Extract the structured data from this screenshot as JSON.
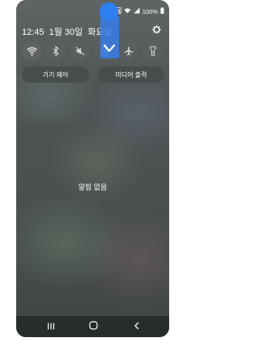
{
  "status_bar": {
    "time": "12:45",
    "date": "1월 30일",
    "weekday": "화요일",
    "battery_percent": "100%",
    "icons": [
      "bluetooth-icon",
      "nfc-icon",
      "wifi-icon",
      "signal-icon",
      "battery-icon"
    ]
  },
  "quick_tiles": [
    {
      "name": "wifi",
      "icon": "wifi-icon",
      "active": true
    },
    {
      "name": "bluetooth",
      "icon": "bluetooth-icon",
      "active": false
    },
    {
      "name": "sound-mute",
      "icon": "mute-icon",
      "active": false
    },
    {
      "name": "portrait-lock",
      "icon": "rotation-lock-icon",
      "active": false
    },
    {
      "name": "airplane-mode",
      "icon": "airplane-icon",
      "active": false
    },
    {
      "name": "flashlight",
      "icon": "flashlight-icon",
      "active": false
    }
  ],
  "buttons": {
    "device_control": "기기 제어",
    "media_output": "미디어 출력"
  },
  "notifications": {
    "empty_text": "알림 없음"
  },
  "gesture_hint": {
    "direction": "down",
    "color": "#2f7ff0"
  },
  "colors": {
    "panel_bg": "#4e5454",
    "tile_bg": "#5a5f5f",
    "accent": "#2f7ff0",
    "text": "#ffffff"
  }
}
